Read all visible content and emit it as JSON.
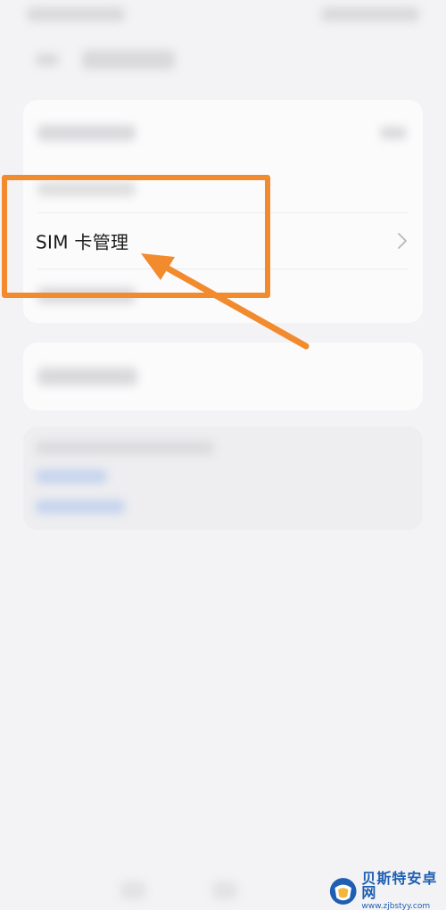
{
  "sim_management": {
    "label": "SIM 卡管理"
  },
  "icons": {
    "chevron": "chevron-right-icon"
  },
  "colors": {
    "highlight": "#f28a2e",
    "watermark": "#1e5fb3"
  },
  "watermark": {
    "title": "贝斯特安卓网",
    "url": "www.zjbstyy.com"
  }
}
